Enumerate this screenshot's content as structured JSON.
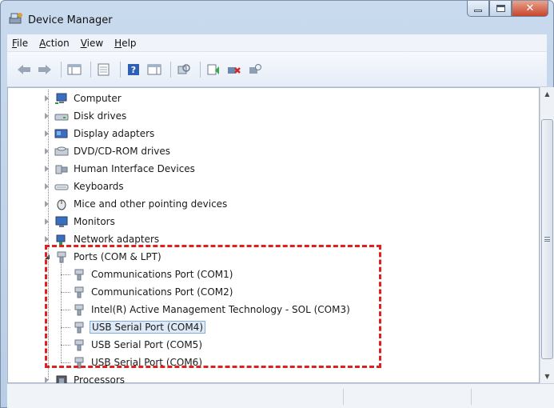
{
  "window": {
    "title": "Device Manager"
  },
  "menu": [
    {
      "label": "File",
      "accel": "F",
      "rest": "ile"
    },
    {
      "label": "Action",
      "accel": "A",
      "rest": "ction"
    },
    {
      "label": "View",
      "accel": "V",
      "rest": "iew"
    },
    {
      "label": "Help",
      "accel": "H",
      "rest": "elp"
    }
  ],
  "toolbar": {
    "buttons": [
      "back-arrow-icon",
      "forward-arrow-icon",
      "show-hide-console-tree-icon",
      "properties-icon",
      "help-icon",
      "action-pane-icon",
      "scan-hardware-icon",
      "update-driver-icon",
      "uninstall-device-icon",
      "disable-device-icon"
    ]
  },
  "tree": {
    "categories": [
      {
        "label": "Computer",
        "icon": "computer-icon",
        "expanded": false
      },
      {
        "label": "Disk drives",
        "icon": "disk-drive-icon",
        "expanded": false
      },
      {
        "label": "Display adapters",
        "icon": "display-adapter-icon",
        "expanded": false
      },
      {
        "label": "DVD/CD-ROM drives",
        "icon": "dvd-drive-icon",
        "expanded": false
      },
      {
        "label": "Human Interface Devices",
        "icon": "hid-icon",
        "expanded": false
      },
      {
        "label": "Keyboards",
        "icon": "keyboard-icon",
        "expanded": false
      },
      {
        "label": "Mice and other pointing devices",
        "icon": "mouse-icon",
        "expanded": false
      },
      {
        "label": "Monitors",
        "icon": "monitor-icon",
        "expanded": false
      },
      {
        "label": "Network adapters",
        "icon": "network-adapter-icon",
        "expanded": false
      },
      {
        "label": "Ports (COM & LPT)",
        "icon": "port-icon",
        "expanded": true,
        "children": [
          {
            "label": "Communications Port (COM1)",
            "selected": false
          },
          {
            "label": "Communications Port (COM2)",
            "selected": false
          },
          {
            "label": "Intel(R) Active Management Technology - SOL (COM3)",
            "selected": false
          },
          {
            "label": "USB Serial Port (COM4)",
            "selected": true
          },
          {
            "label": "USB Serial Port (COM5)",
            "selected": false
          },
          {
            "label": "USB Serial Port (COM6)",
            "selected": false
          }
        ]
      },
      {
        "label": "Processors",
        "icon": "processor-icon",
        "expanded": false
      }
    ]
  },
  "colors": {
    "highlight_border": "#e02020",
    "selection_bg": "#dfeaf8",
    "selection_border": "#84acdd"
  }
}
